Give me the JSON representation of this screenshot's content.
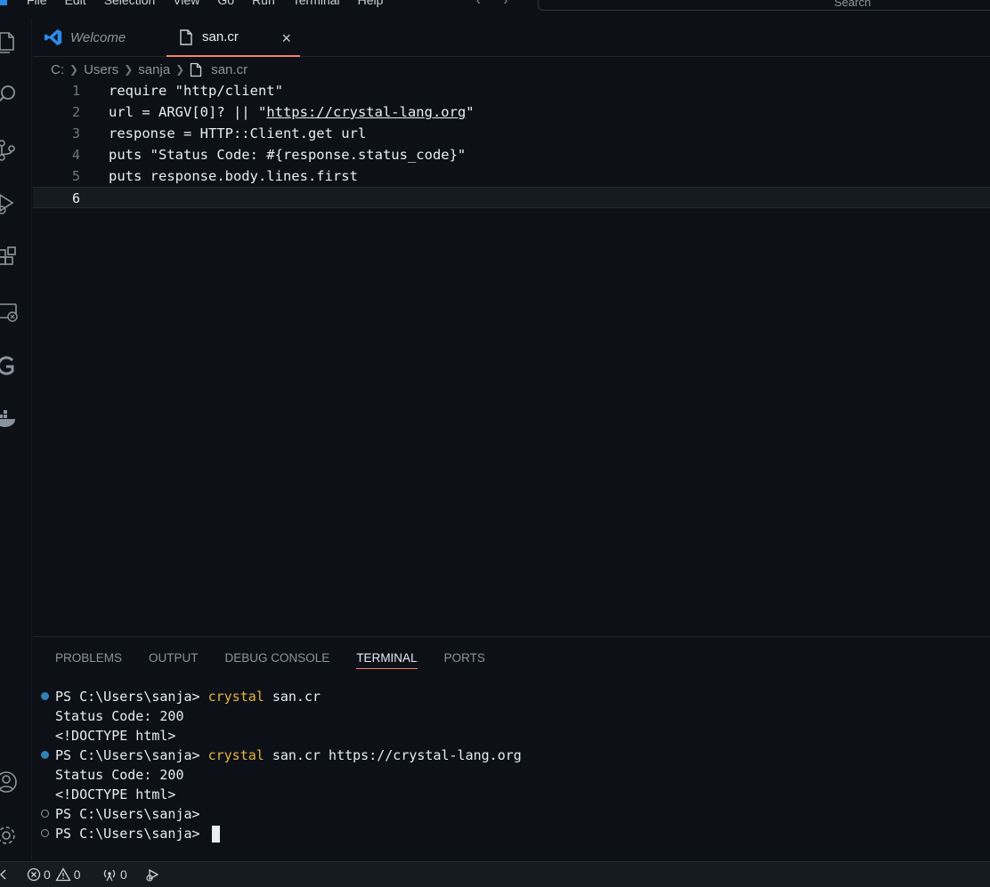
{
  "menu": [
    "File",
    "Edit",
    "Selection",
    "View",
    "Go",
    "Run",
    "Terminal",
    "Help"
  ],
  "nav": {
    "back": "‹",
    "forward": "›"
  },
  "search": {
    "label": "Search"
  },
  "tabs": [
    {
      "label": "Welcome"
    },
    {
      "label": "san.cr",
      "close": "×"
    }
  ],
  "breadcrumb": {
    "drive": "C:",
    "folder1": "Users",
    "folder2": "sanja",
    "file": "san.cr"
  },
  "editor": {
    "lines": [
      {
        "num": "1",
        "text": "require \"http/client\""
      },
      {
        "num": "2",
        "pre": "url = ARGV[0]? || \"",
        "url": "https://crystal-lang.org",
        "post": "\""
      },
      {
        "num": "3",
        "text": "response = HTTP::Client.get url"
      },
      {
        "num": "4",
        "text": "puts \"Status Code: #{response.status_code}\""
      },
      {
        "num": "5",
        "text": "puts response.body.lines.first"
      },
      {
        "num": "6",
        "text": ""
      }
    ]
  },
  "panel": {
    "tabs": [
      "PROBLEMS",
      "OUTPUT",
      "DEBUG CONSOLE",
      "TERMINAL",
      "PORTS"
    ],
    "active_tab": "TERMINAL",
    "terminal": [
      {
        "prompt": "PS C:\\Users\\sanja> ",
        "cmd": "crystal",
        "args": " san.cr"
      },
      {
        "text": "Status Code: 200"
      },
      {
        "text": "<!DOCTYPE html>"
      },
      {
        "prompt": "PS C:\\Users\\sanja> ",
        "cmd": "crystal",
        "args": " san.cr https://crystal-lang.org"
      },
      {
        "text": "Status Code: 200"
      },
      {
        "text": "<!DOCTYPE html>"
      },
      {
        "prompt": "PS C:\\Users\\sanja> "
      },
      {
        "prompt": "PS C:\\Users\\sanja> "
      }
    ]
  },
  "statusbar": {
    "errors": "0",
    "warnings": "0",
    "ports": "0"
  },
  "colors": {
    "accent_tab": "#f78166",
    "command": "#e3b341",
    "dot_blue": "#2f81b7"
  }
}
